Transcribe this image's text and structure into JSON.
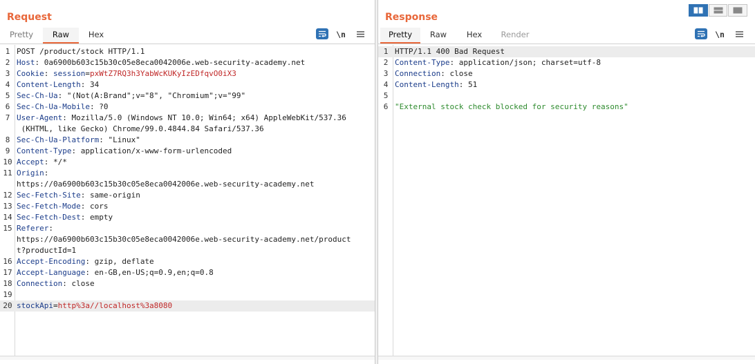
{
  "request": {
    "title": "Request",
    "tabs": [
      "Pretty",
      "Raw",
      "Hex"
    ],
    "active_tab": "Raw",
    "newline_label": "\\n",
    "lines": [
      {
        "n": "1",
        "segs": [
          {
            "t": "POST /product/stock HTTP/1.1",
            "c": ""
          }
        ]
      },
      {
        "n": "2",
        "segs": [
          {
            "t": "Host",
            "c": "hk"
          },
          {
            "t": ": 0a6900b603c15b30c05e8eca0042006e.web-security-academy.net",
            "c": ""
          }
        ]
      },
      {
        "n": "3",
        "segs": [
          {
            "t": "Cookie",
            "c": "hk"
          },
          {
            "t": ": ",
            "c": ""
          },
          {
            "t": "session",
            "c": "hk"
          },
          {
            "t": "=",
            "c": ""
          },
          {
            "t": "pxWtZ7RQ3h3YabWcKUKyIzEDfqvO0iX3",
            "c": "ck"
          }
        ]
      },
      {
        "n": "4",
        "segs": [
          {
            "t": "Content-Length",
            "c": "hk"
          },
          {
            "t": ": 34",
            "c": ""
          }
        ]
      },
      {
        "n": "5",
        "segs": [
          {
            "t": "Sec-Ch-Ua",
            "c": "hk"
          },
          {
            "t": ": \"(Not(A:Brand\";v=\"8\", \"Chromium\";v=\"99\"",
            "c": ""
          }
        ]
      },
      {
        "n": "6",
        "segs": [
          {
            "t": "Sec-Ch-Ua-Mobile",
            "c": "hk"
          },
          {
            "t": ": ?0",
            "c": ""
          }
        ]
      },
      {
        "n": "7",
        "segs": [
          {
            "t": "User-Agent",
            "c": "hk"
          },
          {
            "t": ": Mozilla/5.0 (Windows NT 10.0; Win64; x64) AppleWebKit/537.36",
            "c": ""
          }
        ]
      },
      {
        "n": "",
        "segs": [
          {
            "t": " (KHTML, like Gecko) Chrome/99.0.4844.84 Safari/537.36",
            "c": ""
          }
        ]
      },
      {
        "n": "8",
        "segs": [
          {
            "t": "Sec-Ch-Ua-Platform",
            "c": "hk"
          },
          {
            "t": ": \"Linux\"",
            "c": ""
          }
        ]
      },
      {
        "n": "9",
        "segs": [
          {
            "t": "Content-Type",
            "c": "hk"
          },
          {
            "t": ": application/x-www-form-urlencoded",
            "c": ""
          }
        ]
      },
      {
        "n": "10",
        "segs": [
          {
            "t": "Accept",
            "c": "hk"
          },
          {
            "t": ": */*",
            "c": ""
          }
        ]
      },
      {
        "n": "11",
        "segs": [
          {
            "t": "Origin",
            "c": "hk"
          },
          {
            "t": ":",
            "c": ""
          }
        ]
      },
      {
        "n": "",
        "segs": [
          {
            "t": "https://0a6900b603c15b30c05e8eca0042006e.web-security-academy.net",
            "c": ""
          }
        ]
      },
      {
        "n": "12",
        "segs": [
          {
            "t": "Sec-Fetch-Site",
            "c": "hk"
          },
          {
            "t": ": same-origin",
            "c": ""
          }
        ]
      },
      {
        "n": "13",
        "segs": [
          {
            "t": "Sec-Fetch-Mode",
            "c": "hk"
          },
          {
            "t": ": cors",
            "c": ""
          }
        ]
      },
      {
        "n": "14",
        "segs": [
          {
            "t": "Sec-Fetch-Dest",
            "c": "hk"
          },
          {
            "t": ": empty",
            "c": ""
          }
        ]
      },
      {
        "n": "15",
        "segs": [
          {
            "t": "Referer",
            "c": "hk"
          },
          {
            "t": ":",
            "c": ""
          }
        ]
      },
      {
        "n": "",
        "segs": [
          {
            "t": "https://0a6900b603c15b30c05e8eca0042006e.web-security-academy.net/product",
            "c": ""
          }
        ]
      },
      {
        "n": "",
        "segs": [
          {
            "t": "t?productId=1",
            "c": ""
          }
        ]
      },
      {
        "n": "16",
        "segs": [
          {
            "t": "Accept-Encoding",
            "c": "hk"
          },
          {
            "t": ": gzip, deflate",
            "c": ""
          }
        ]
      },
      {
        "n": "17",
        "segs": [
          {
            "t": "Accept-Language",
            "c": "hk"
          },
          {
            "t": ": en-GB,en-US;q=0.9,en;q=0.8",
            "c": ""
          }
        ]
      },
      {
        "n": "18",
        "segs": [
          {
            "t": "Connection",
            "c": "hk"
          },
          {
            "t": ": close",
            "c": ""
          }
        ]
      },
      {
        "n": "19",
        "segs": []
      },
      {
        "n": "20",
        "hl": true,
        "segs": [
          {
            "t": "stockApi",
            "c": "ps"
          },
          {
            "t": "=",
            "c": ""
          },
          {
            "t": "http%3a//localhost%3a8080",
            "c": "pv"
          }
        ]
      }
    ]
  },
  "response": {
    "title": "Response",
    "tabs": [
      "Pretty",
      "Raw",
      "Hex",
      "Render"
    ],
    "active_tab": "Pretty",
    "newline_label": "\\n",
    "lines": [
      {
        "n": "1",
        "hl": true,
        "segs": [
          {
            "t": "HTTP/1.1 400 Bad Request",
            "c": ""
          }
        ]
      },
      {
        "n": "2",
        "segs": [
          {
            "t": "Content-Type",
            "c": "hk"
          },
          {
            "t": ": application/json; charset=utf-8",
            "c": ""
          }
        ]
      },
      {
        "n": "3",
        "segs": [
          {
            "t": "Connection",
            "c": "hk"
          },
          {
            "t": ": close",
            "c": ""
          }
        ]
      },
      {
        "n": "4",
        "segs": [
          {
            "t": "Content-Length",
            "c": "hk"
          },
          {
            "t": ": 51",
            "c": ""
          }
        ]
      },
      {
        "n": "5",
        "segs": []
      },
      {
        "n": "6",
        "segs": [
          {
            "t": "\"External stock check blocked for security reasons\"",
            "c": "gj"
          }
        ]
      }
    ]
  },
  "colors": {
    "accent": "#e8673a",
    "header_key": "#1b3c8a",
    "value_red": "#c02828",
    "json_string": "#2e8b2e",
    "button_blue": "#2f72b4"
  },
  "icons": [
    "wrap-lines-icon",
    "newline-icon",
    "menu-icon",
    "layout-side-by-side-icon",
    "layout-top-bottom-icon",
    "layout-tabs-icon"
  ]
}
